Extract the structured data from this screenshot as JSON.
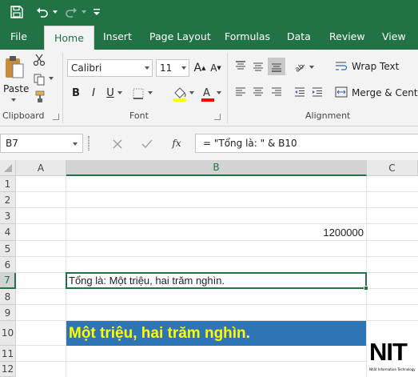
{
  "ribbon_tabs": [
    {
      "label": "File"
    },
    {
      "label": "Home"
    },
    {
      "label": "Insert"
    },
    {
      "label": "Page Layout"
    },
    {
      "label": "Formulas"
    },
    {
      "label": "Data"
    },
    {
      "label": "Review"
    },
    {
      "label": "View"
    }
  ],
  "clipboard": {
    "paste_label": "Paste",
    "group_label": "Clipboard"
  },
  "font": {
    "family": "Calibri",
    "size": "11",
    "group_label": "Font",
    "bold": "B",
    "italic": "I",
    "underline": "U",
    "grow": "A",
    "shrink": "A"
  },
  "alignment": {
    "wrap_text": "Wrap Text",
    "merge_center": "Merge & Center",
    "group_label": "Alignment"
  },
  "formula_bar": {
    "name_box": "B7",
    "fx": "fx",
    "formula": "= \"Tổng là: \" & B10"
  },
  "columns": [
    {
      "label": "A"
    },
    {
      "label": "B"
    },
    {
      "label": "C"
    }
  ],
  "rows": [
    "1",
    "2",
    "3",
    "4",
    "5",
    "6",
    "7",
    "8",
    "9",
    "10",
    "11",
    "12"
  ],
  "cells": {
    "B4": "1200000",
    "B7": "Tổng là: Một triệu, hai trăm nghìn.",
    "B10": "Một triệu, hai trăm nghìn."
  },
  "logo": {
    "text": "NIT",
    "tagline": "Nhất Information Technology"
  },
  "colors": {
    "accent": "#217346",
    "banner": "#2e75b6",
    "banner_text": "#ffff00"
  }
}
